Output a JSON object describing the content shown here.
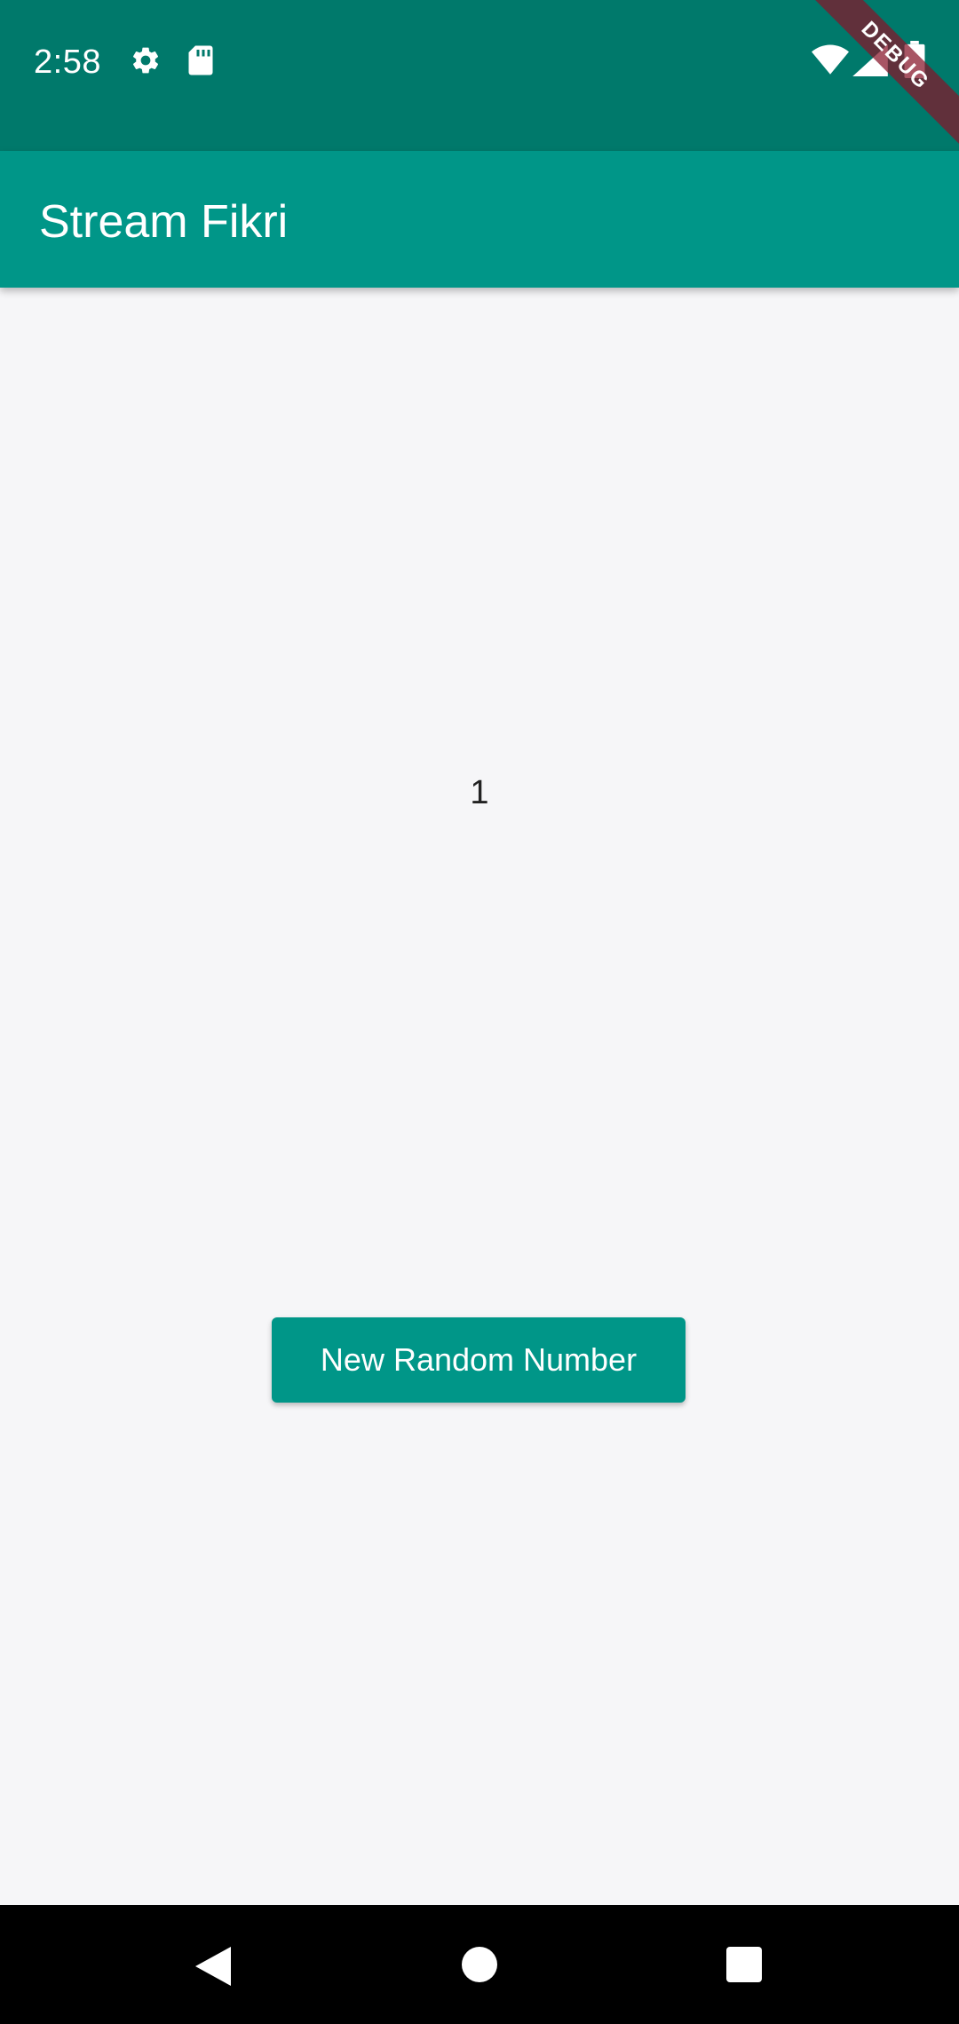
{
  "status_bar": {
    "time": "2:58",
    "icons": [
      "gear-icon",
      "sd-card-icon",
      "wifi-icon",
      "signal-icon",
      "battery-icon"
    ],
    "background_color": "#00796b"
  },
  "debug_banner": {
    "label": "DEBUG",
    "color": "#871428"
  },
  "app_bar": {
    "title": "Stream Fikri",
    "background_color": "#009688"
  },
  "content": {
    "number_value": "1"
  },
  "button": {
    "label": "New Random Number",
    "color": "#009688"
  },
  "nav_bar": {
    "icons": [
      "back-icon",
      "home-icon",
      "recents-icon"
    ]
  }
}
